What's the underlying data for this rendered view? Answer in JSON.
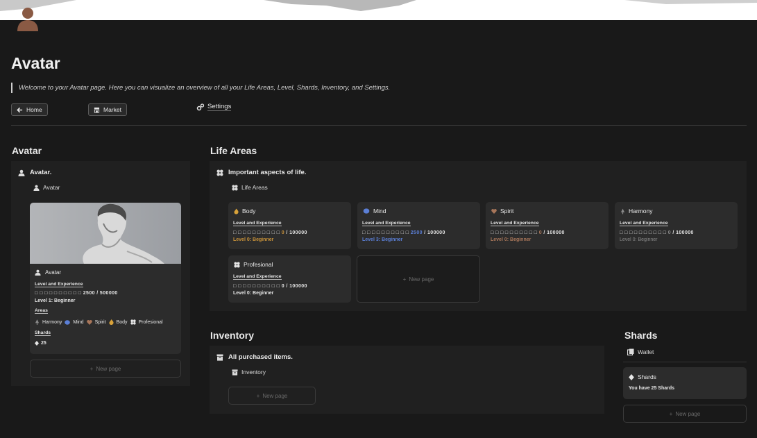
{
  "page": {
    "title": "Avatar",
    "description": "Welcome to your Avatar page. Here you can visualize an overview of all your Life Areas, Level, Shards, Inventory, and Settings."
  },
  "nav": {
    "home_label": "Home",
    "market_label": "Market",
    "settings_label": "Settings"
  },
  "avatar_section": {
    "heading": "Avatar",
    "db_title": "Avatar.",
    "view_label": "Avatar",
    "card": {
      "title": "Avatar",
      "level_exp_label": "Level and Experience",
      "progress": "□ □ □ □ □ □ □ □ □ □ 2500 / 500000",
      "level": "Level 1: Beginner",
      "areas_label": "Areas",
      "areas": [
        "Harmony",
        "Mind",
        "Spirit",
        "Body",
        "Profesional"
      ],
      "shards_label": "Shards",
      "shards_value": "25"
    },
    "new_page": "New page"
  },
  "life_areas": {
    "heading": "Life Areas",
    "db_title": "Important aspects of life.",
    "view_label": "Life Areas",
    "cards": [
      {
        "name": "Body",
        "icon": "fire-icon",
        "level_exp_label": "Level and Experience",
        "boxes": "□ □ □ □ □ □ □ □ □ □",
        "current": "0",
        "total": "/ 100000",
        "level": "Level 0: Beginner",
        "accent": "#c8923a"
      },
      {
        "name": "Mind",
        "icon": "brain-icon",
        "level_exp_label": "Level and Experience",
        "boxes": "□ □ □ □ □ □ □ □ □ □",
        "current": "2500",
        "total": "/ 100000",
        "level": "Level 3: Beginner",
        "accent": "#5b7fd6"
      },
      {
        "name": "Spirit",
        "icon": "heart-icon",
        "level_exp_label": "Level and Experience",
        "boxes": "□ □ □ □ □ □ □ □ □ □",
        "current": "0",
        "total": "/ 100000",
        "level": "Level 0: Beginner",
        "accent": "#a8765a"
      },
      {
        "name": "Harmony",
        "icon": "tree-icon",
        "level_exp_label": "Level and Experience",
        "boxes": "□ □ □ □ □ □ □ □ □ □",
        "current": "0",
        "total": "/ 100000",
        "level": "Level 0: Beginner",
        "accent": "#8a8a8a"
      },
      {
        "name": "Profesional",
        "icon": "clover-icon",
        "level_exp_label": "Level and Experience",
        "boxes": "□ □ □ □ □ □ □ □ □ □",
        "current": "0",
        "total": "/ 100000",
        "level": "Level 0: Beginner",
        "accent": "#e6e6e6"
      }
    ],
    "new_page": "New page"
  },
  "inventory": {
    "heading": "Inventory",
    "db_title": "All purchased items.",
    "view_label": "Inventory",
    "new_page": "New page"
  },
  "shards": {
    "heading": "Shards",
    "view_label": "Wallet",
    "card_title": "Shards",
    "card_text": "You have 25 Shards",
    "new_page": "New page"
  }
}
